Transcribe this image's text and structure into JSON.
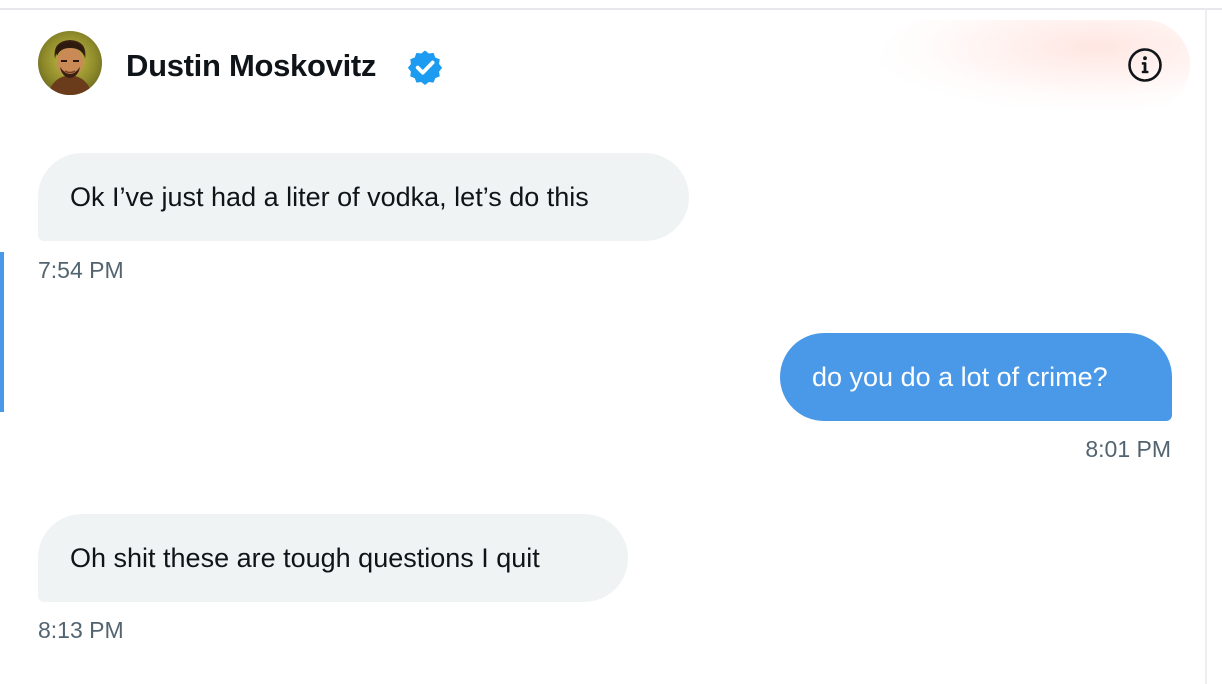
{
  "conversation": {
    "contact_name": "Dustin Moskovitz",
    "avatar_icon": "avatar-portrait",
    "verified_icon": "verified-badge-icon",
    "info_icon": "info-icon"
  },
  "colors": {
    "accent": "#4a99e9",
    "received_bubble": "#eff3f4",
    "text_primary": "#0f1419",
    "text_secondary": "#536471"
  },
  "messages": [
    {
      "direction": "received",
      "text": "Ok I’ve just had a liter of vodka, let’s do this",
      "time": "7:54 PM"
    },
    {
      "direction": "sent",
      "text": "do you do a lot of crime?",
      "time": "8:01 PM"
    },
    {
      "direction": "received",
      "text": "Oh shit these are tough questions I quit",
      "time": "8:13 PM"
    }
  ]
}
